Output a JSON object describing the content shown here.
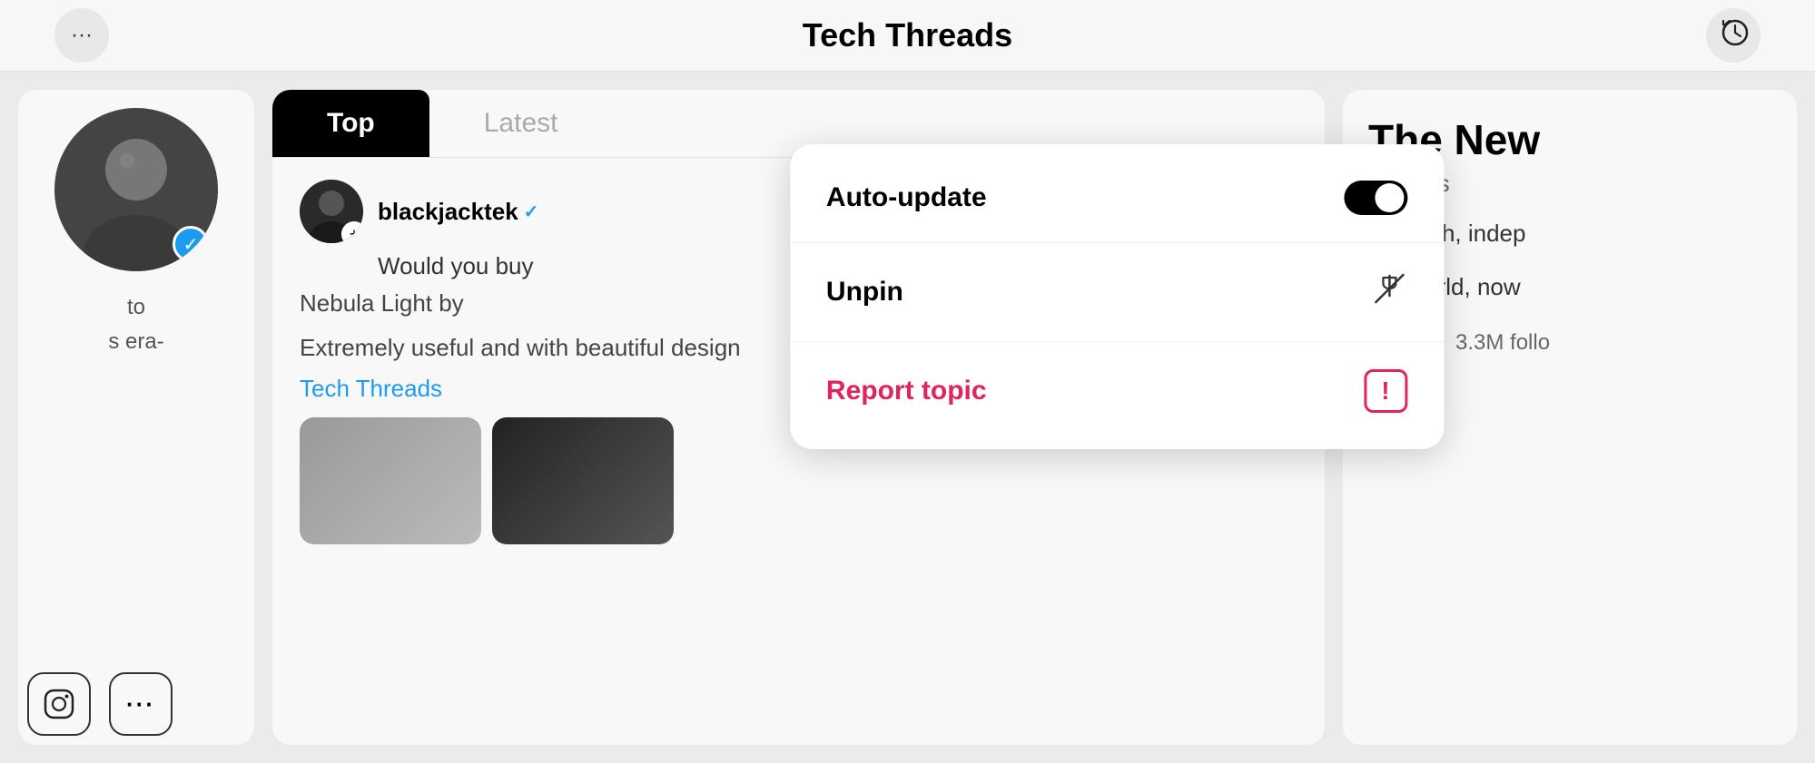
{
  "header": {
    "title": "Tech Threads",
    "left_button_label": "···",
    "right_button_label": "history"
  },
  "dropdown": {
    "items": [
      {
        "id": "auto-update",
        "label": "Auto-update",
        "type": "toggle",
        "toggled": true
      },
      {
        "id": "unpin",
        "label": "Unpin",
        "type": "icon-unpin"
      },
      {
        "id": "report",
        "label": "Report topic",
        "type": "icon-report",
        "color": "red"
      }
    ]
  },
  "left_panel": {
    "follow_label_to": "to",
    "follow_label_era": "s era-"
  },
  "bottom_icons": [
    {
      "id": "instagram-icon",
      "label": "Instagram"
    },
    {
      "id": "more-icon",
      "label": "More"
    }
  ],
  "middle_panel": {
    "tabs": [
      {
        "id": "top",
        "label": "Top",
        "active": true
      },
      {
        "id": "latest",
        "label": "Latest",
        "active": false
      }
    ],
    "post": {
      "username": "blackjacktek",
      "verified": true,
      "text_preview": "Would you buy",
      "body_line1": "Nebula Light by",
      "body_line2": "Extremely useful and with beautiful design",
      "tag": "Tech Threads"
    }
  },
  "right_panel": {
    "title": "The New",
    "source": "nytimes",
    "description_line1": "In-depth, indep",
    "description_line2": "the world, now",
    "followers_count": "3.3M follo"
  }
}
